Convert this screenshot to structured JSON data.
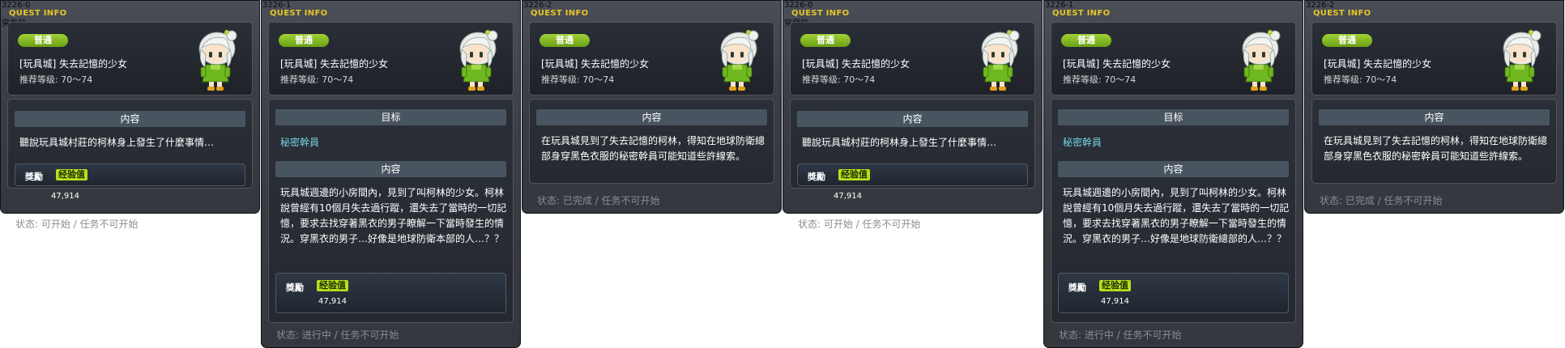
{
  "common": {
    "qinfo_label": "QUEST INFO",
    "badge": "普通",
    "title": "[玩具城] 失去記憶的少女",
    "level": "推荐等级:  70～74",
    "content_label": "内容",
    "target_label": "目标",
    "target_item": "秘密幹員",
    "reward_label": "獎勵",
    "reward_tag": "经验值",
    "reward_value": "47,914"
  },
  "panels": [
    {
      "id": "3226-0",
      "state_caption": "突发前",
      "desc": "聽說玩具城村莊的柯林身上發生了什麼事情…",
      "status": "状态:  可开始  /  任务不可开始"
    },
    {
      "id": "3226-1",
      "desc": "玩具城週邊的小房間內，見到了叫柯林的少女。柯林說曾經有10個月失去過行蹤，還失去了當時的一切記憶，要求去找穿著黑衣的男子瞭解一下當時發生的情況。穿黑衣的男子…好像是地球防衛本部的人…？？",
      "status": "状态:  进行中  /  任务不可开始"
    },
    {
      "id": "3226-2",
      "desc": "在玩具城見到了失去記憶的柯林，得知在地球防衛總部身穿黑色衣服的秘密幹員可能知道些許線索。",
      "status": "状态:  已完成  /  任务不可开始"
    },
    {
      "id": "3226-0",
      "state_caption": "突發前",
      "desc": "聽說玩具城村莊的柯林身上發生了什麼事情…",
      "status": "状态:  可开始  /  任务不可开始"
    },
    {
      "id": "3226-1",
      "desc": "玩具城週邊的小房間內，見到了叫柯林的少女。柯林說曾經有10個月失去過行蹤，還失去了當時的一切記憶，要求去找穿著黑衣的男子瞭解一下當時發生的情況。穿黑衣的男子…好像是地球防衛總部的人…？？",
      "status": "状态:  进行中  /  任务不可开始"
    },
    {
      "id": "3226-2",
      "desc": "在玩具城見到了失去記憶的柯林，得知在地球防衛總部身穿黑色衣服的秘密幹員可能知道些許線索。",
      "status": "状态:  已完成  /  任务不可开始"
    }
  ],
  "colors": {
    "panel_bg": "#3b3e45",
    "accent_yellow": "#e6c52a",
    "badge_green": "#8cc22a",
    "target_cyan": "#74d4e4",
    "reward_tag_green": "#b7e11b",
    "status_gray": "#8a8d92"
  }
}
